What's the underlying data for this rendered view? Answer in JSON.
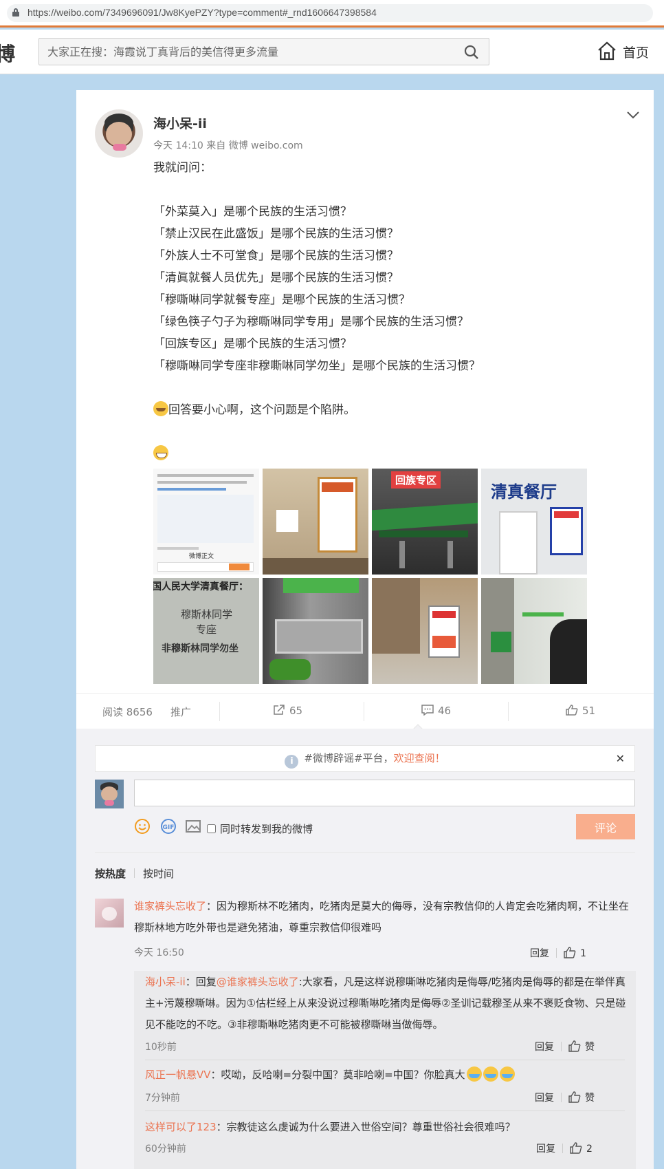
{
  "browser": {
    "url": "https://weibo.com/7349696091/Jw8KyePZY?type=comment#_rnd1606647398584"
  },
  "header": {
    "logo_fragment": "博",
    "search_placeholder": "大家正在搜：海霞说丁真背后的美信得更多流量",
    "home_label": "首页"
  },
  "post": {
    "author": "海小呆-ii",
    "meta": "今天 14:10 来自 微博 weibo.com",
    "lines": [
      "我就问问：",
      "",
      "「外菜莫入」是哪个民族的生活习惯？",
      "「禁止汉民在此盛饭」是哪个民族的生活习惯？",
      "「外族人士不可堂食」是哪个民族的生活习惯？",
      "「清眞就餐人员优先」是哪个民族的生活习惯？",
      "「穆嘶啉同学就餐专座」是哪个民族的生活习惯？",
      "「绿色筷子勺子为穆嘶啉同学专用」是哪个民族的生活习惯？",
      "「回族专区」是哪个民族的生活习惯？",
      "「穆嘶啉同学专座非穆嘶啉同学勿坐」是哪个民族的生活习惯？",
      "",
      "回答要小心啊，这个问题是个陷阱。"
    ],
    "photos": [
      {
        "caption": "微博正文",
        "color": "#f4f4f4"
      },
      {
        "caption": "禁止汉民在此盛饭",
        "color": "#c9b59a"
      },
      {
        "caption": "回族专区",
        "color": "#3a6b3a"
      },
      {
        "caption": "清真餐厅",
        "color": "#e8e8e8"
      },
      {
        "caption": "国人民大学清真餐厅：",
        "color": "#b9bcb5"
      },
      {
        "caption": "穆斯林同学专座 非穆斯林同学勿坐",
        "color": "#6b6b6b"
      },
      {
        "caption": "",
        "color": "#a08e76"
      },
      {
        "caption": "",
        "color": "#cfd3cc"
      }
    ],
    "photo_texts": {
      "p5_line1": "穆斯林同学",
      "p5_line2": "专座",
      "p5_line3": "非穆斯林同学勿坐",
      "p4_title": "清真餐厅",
      "p3_banner": "回族专区"
    }
  },
  "stats": {
    "reads": "阅读 8656",
    "promote": "推广",
    "reposts": "65",
    "comments": "46",
    "likes": "51"
  },
  "compose": {
    "notice_prefix": "#微博辟谣#平台，",
    "notice_link": "欢迎查阅！",
    "forward_label": "同时转发到我的微博",
    "submit_label": "评论"
  },
  "sort": {
    "hot": "按热度",
    "time": "按时间"
  },
  "comment": {
    "user": "谁家裤头忘收了",
    "text": "：因为穆斯林不吃猪肉，吃猪肉是莫大的侮辱，没有宗教信仰的人肯定会吃猪肉啊，不让坐在穆斯林地方吃外带也是避免猪油，尊重宗教信仰很难吗",
    "time": "今天 16:50",
    "reply_label": "回复",
    "likes": "1"
  },
  "replies": [
    {
      "user": "海小呆-ii",
      "prefix": "：回复",
      "mention": "@谁家裤头忘收了",
      "text": ":大家看，凡是这样说穆嘶啉吃猪肉是侮辱/吃猪肉是侮辱的都是在举伴真主+污蔑穆嘶啉。因为①估栏经上从来没说过穆嘶啉吃猪肉是侮辱②圣训记载穆圣从来不褒贬食物、只是碰见不能吃的不吃。③非穆嘶啉吃猪肉更不可能被穆嘶啉当做侮辱。",
      "time": "10秒前",
      "reply_label": "回复",
      "like_label": "赞"
    },
    {
      "user": "风正一帆悬VV",
      "text": "：哎呦，反哈喇=分裂中国？莫非哈喇=中国？你脸真大",
      "time": "7分钟前",
      "reply_label": "回复",
      "like_label": "赞"
    },
    {
      "user": "这样可以了123",
      "text": "：宗教徒这么虔诚为什么要进入世俗空间？尊重世俗社会很难吗？",
      "time": "60分钟前",
      "reply_label": "回复",
      "like_label": "2"
    }
  ],
  "colors": {
    "accent": "#eb7350",
    "submit_disabled": "#f9ae8d",
    "page_bg": "#b9d7ee"
  },
  "icons": [
    "lock-icon",
    "search-icon",
    "home-icon",
    "chevron-down-icon",
    "repost-icon",
    "comment-icon",
    "like-icon",
    "info-icon",
    "close-icon",
    "emoji-icon",
    "gif-icon",
    "image-icon"
  ]
}
